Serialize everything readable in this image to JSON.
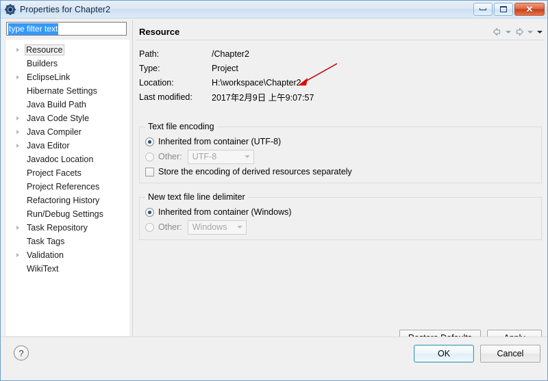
{
  "window": {
    "title": "Properties for Chapter2",
    "icon": "gear-icon",
    "controls": {
      "minimize": "Minimize",
      "maximize": "Maximize",
      "close": "Close",
      "close_glyph": "✕"
    }
  },
  "filter": {
    "value": "type filter text",
    "placeholder": "type filter text"
  },
  "tree": {
    "items": [
      {
        "label": "Resource",
        "expandable": true,
        "selected": true
      },
      {
        "label": "Builders",
        "expandable": false,
        "selected": false
      },
      {
        "label": "EclipseLink",
        "expandable": true,
        "selected": false
      },
      {
        "label": "Hibernate Settings",
        "expandable": false,
        "selected": false
      },
      {
        "label": "Java Build Path",
        "expandable": false,
        "selected": false
      },
      {
        "label": "Java Code Style",
        "expandable": true,
        "selected": false
      },
      {
        "label": "Java Compiler",
        "expandable": true,
        "selected": false
      },
      {
        "label": "Java Editor",
        "expandable": true,
        "selected": false
      },
      {
        "label": "Javadoc Location",
        "expandable": false,
        "selected": false
      },
      {
        "label": "Project Facets",
        "expandable": false,
        "selected": false
      },
      {
        "label": "Project References",
        "expandable": false,
        "selected": false
      },
      {
        "label": "Refactoring History",
        "expandable": false,
        "selected": false
      },
      {
        "label": "Run/Debug Settings",
        "expandable": false,
        "selected": false
      },
      {
        "label": "Task Repository",
        "expandable": true,
        "selected": false
      },
      {
        "label": "Task Tags",
        "expandable": false,
        "selected": false
      },
      {
        "label": "Validation",
        "expandable": true,
        "selected": false
      },
      {
        "label": "WikiText",
        "expandable": false,
        "selected": false
      }
    ]
  },
  "page": {
    "title": "Resource",
    "nav": {
      "back": "back-arrow",
      "back_menu": "back-dropdown",
      "forward": "forward-arrow",
      "forward_menu": "forward-dropdown",
      "view_menu": "view-menu"
    },
    "properties": [
      {
        "label": "Path:",
        "value": "/Chapter2"
      },
      {
        "label": "Type:",
        "value": "Project"
      },
      {
        "label": "Location:",
        "value": "H:\\workspace\\Chapter2"
      },
      {
        "label": "Last modified:",
        "value": "2017年2月9日 上午9:07:57"
      }
    ],
    "encoding_group": {
      "legend": "Text file encoding",
      "inherited_label": "Inherited from container (UTF-8)",
      "inherited_selected": true,
      "other_label": "Other:",
      "other_selected": false,
      "other_value": "UTF-8",
      "store_derived_label": "Store the encoding of derived resources separately",
      "store_derived_checked": false
    },
    "delimiter_group": {
      "legend": "New text file line delimiter",
      "inherited_label": "Inherited from container (Windows)",
      "inherited_selected": true,
      "other_label": "Other:",
      "other_selected": false,
      "other_value": "Windows"
    },
    "buttons": {
      "restore_defaults": "Restore Defaults",
      "apply": "Apply"
    }
  },
  "footer": {
    "help": "?",
    "ok": "OK",
    "cancel": "Cancel"
  },
  "annotation": {
    "type": "red-arrow",
    "color": "#d40000",
    "points_to": "H:\\workspace\\Chapter2"
  }
}
